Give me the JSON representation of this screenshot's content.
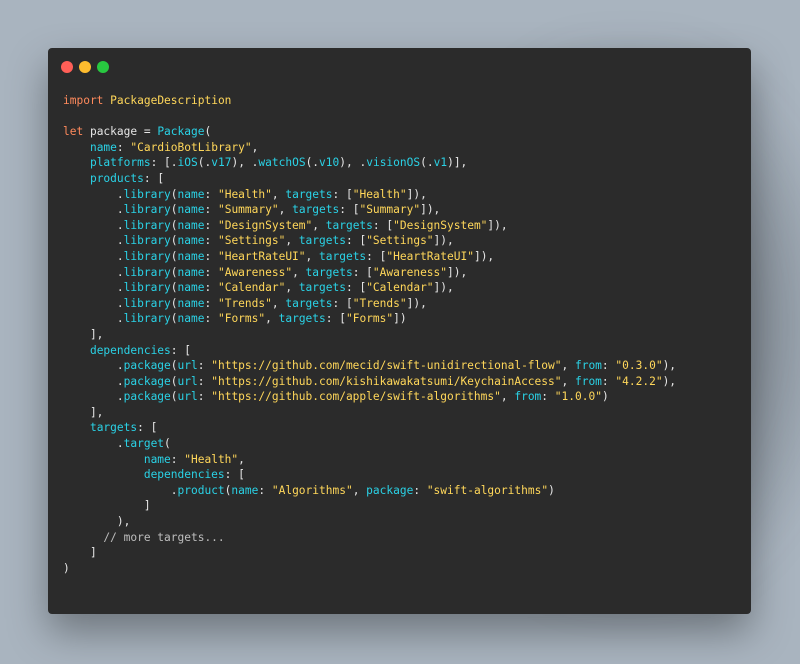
{
  "window": {
    "buttons": {
      "close": "close-button",
      "minimize": "minimize-button",
      "zoom": "zoom-button"
    }
  },
  "colors": {
    "background": "#a9b4bf",
    "window": "#2b2b2b",
    "keyword": "#ff8a5c",
    "type": "#2ad2e6",
    "string": "#ffd75a",
    "plain": "#e6e6e6"
  },
  "code": [
    [
      [
        "k",
        "import"
      ],
      [
        "p",
        " "
      ],
      [
        "s",
        "PackageDescription"
      ]
    ],
    [],
    [
      [
        "k",
        "let"
      ],
      [
        "p",
        " package = "
      ],
      [
        "t",
        "Package"
      ],
      [
        "p",
        "("
      ]
    ],
    [
      [
        "p",
        "    "
      ],
      [
        "t",
        "name"
      ],
      [
        "p",
        ": "
      ],
      [
        "s",
        "\"CardioBotLibrary\""
      ],
      [
        "p",
        ","
      ]
    ],
    [
      [
        "p",
        "    "
      ],
      [
        "t",
        "platforms"
      ],
      [
        "p",
        ": [."
      ],
      [
        "t",
        "iOS"
      ],
      [
        "p",
        "(."
      ],
      [
        "t",
        "v17"
      ],
      [
        "p",
        "), ."
      ],
      [
        "t",
        "watchOS"
      ],
      [
        "p",
        "(."
      ],
      [
        "t",
        "v10"
      ],
      [
        "p",
        "), ."
      ],
      [
        "t",
        "visionOS"
      ],
      [
        "p",
        "(."
      ],
      [
        "t",
        "v1"
      ],
      [
        "p",
        ")],"
      ]
    ],
    [
      [
        "p",
        "    "
      ],
      [
        "t",
        "products"
      ],
      [
        "p",
        ": ["
      ]
    ],
    [
      [
        "p",
        "        ."
      ],
      [
        "t",
        "library"
      ],
      [
        "p",
        "("
      ],
      [
        "t",
        "name"
      ],
      [
        "p",
        ": "
      ],
      [
        "s",
        "\"Health\""
      ],
      [
        "p",
        ", "
      ],
      [
        "t",
        "targets"
      ],
      [
        "p",
        ": ["
      ],
      [
        "s",
        "\"Health\""
      ],
      [
        "p",
        "]),"
      ]
    ],
    [
      [
        "p",
        "        ."
      ],
      [
        "t",
        "library"
      ],
      [
        "p",
        "("
      ],
      [
        "t",
        "name"
      ],
      [
        "p",
        ": "
      ],
      [
        "s",
        "\"Summary\""
      ],
      [
        "p",
        ", "
      ],
      [
        "t",
        "targets"
      ],
      [
        "p",
        ": ["
      ],
      [
        "s",
        "\"Summary\""
      ],
      [
        "p",
        "]),"
      ]
    ],
    [
      [
        "p",
        "        ."
      ],
      [
        "t",
        "library"
      ],
      [
        "p",
        "("
      ],
      [
        "t",
        "name"
      ],
      [
        "p",
        ": "
      ],
      [
        "s",
        "\"DesignSystem\""
      ],
      [
        "p",
        ", "
      ],
      [
        "t",
        "targets"
      ],
      [
        "p",
        ": ["
      ],
      [
        "s",
        "\"DesignSystem\""
      ],
      [
        "p",
        "]),"
      ]
    ],
    [
      [
        "p",
        "        ."
      ],
      [
        "t",
        "library"
      ],
      [
        "p",
        "("
      ],
      [
        "t",
        "name"
      ],
      [
        "p",
        ": "
      ],
      [
        "s",
        "\"Settings\""
      ],
      [
        "p",
        ", "
      ],
      [
        "t",
        "targets"
      ],
      [
        "p",
        ": ["
      ],
      [
        "s",
        "\"Settings\""
      ],
      [
        "p",
        "]),"
      ]
    ],
    [
      [
        "p",
        "        ."
      ],
      [
        "t",
        "library"
      ],
      [
        "p",
        "("
      ],
      [
        "t",
        "name"
      ],
      [
        "p",
        ": "
      ],
      [
        "s",
        "\"HeartRateUI\""
      ],
      [
        "p",
        ", "
      ],
      [
        "t",
        "targets"
      ],
      [
        "p",
        ": ["
      ],
      [
        "s",
        "\"HeartRateUI\""
      ],
      [
        "p",
        "]),"
      ]
    ],
    [
      [
        "p",
        "        ."
      ],
      [
        "t",
        "library"
      ],
      [
        "p",
        "("
      ],
      [
        "t",
        "name"
      ],
      [
        "p",
        ": "
      ],
      [
        "s",
        "\"Awareness\""
      ],
      [
        "p",
        ", "
      ],
      [
        "t",
        "targets"
      ],
      [
        "p",
        ": ["
      ],
      [
        "s",
        "\"Awareness\""
      ],
      [
        "p",
        "]),"
      ]
    ],
    [
      [
        "p",
        "        ."
      ],
      [
        "t",
        "library"
      ],
      [
        "p",
        "("
      ],
      [
        "t",
        "name"
      ],
      [
        "p",
        ": "
      ],
      [
        "s",
        "\"Calendar\""
      ],
      [
        "p",
        ", "
      ],
      [
        "t",
        "targets"
      ],
      [
        "p",
        ": ["
      ],
      [
        "s",
        "\"Calendar\""
      ],
      [
        "p",
        "]),"
      ]
    ],
    [
      [
        "p",
        "        ."
      ],
      [
        "t",
        "library"
      ],
      [
        "p",
        "("
      ],
      [
        "t",
        "name"
      ],
      [
        "p",
        ": "
      ],
      [
        "s",
        "\"Trends\""
      ],
      [
        "p",
        ", "
      ],
      [
        "t",
        "targets"
      ],
      [
        "p",
        ": ["
      ],
      [
        "s",
        "\"Trends\""
      ],
      [
        "p",
        "]),"
      ]
    ],
    [
      [
        "p",
        "        ."
      ],
      [
        "t",
        "library"
      ],
      [
        "p",
        "("
      ],
      [
        "t",
        "name"
      ],
      [
        "p",
        ": "
      ],
      [
        "s",
        "\"Forms\""
      ],
      [
        "p",
        ", "
      ],
      [
        "t",
        "targets"
      ],
      [
        "p",
        ": ["
      ],
      [
        "s",
        "\"Forms\""
      ],
      [
        "p",
        "])"
      ]
    ],
    [
      [
        "p",
        "    ],"
      ]
    ],
    [
      [
        "p",
        "    "
      ],
      [
        "t",
        "dependencies"
      ],
      [
        "p",
        ": ["
      ]
    ],
    [
      [
        "p",
        "        ."
      ],
      [
        "t",
        "package"
      ],
      [
        "p",
        "("
      ],
      [
        "t",
        "url"
      ],
      [
        "p",
        ": "
      ],
      [
        "s",
        "\"https://github.com/mecid/swift-unidirectional-flow\""
      ],
      [
        "p",
        ", "
      ],
      [
        "t",
        "from"
      ],
      [
        "p",
        ": "
      ],
      [
        "s",
        "\"0.3.0\""
      ],
      [
        "p",
        "),"
      ]
    ],
    [
      [
        "p",
        "        ."
      ],
      [
        "t",
        "package"
      ],
      [
        "p",
        "("
      ],
      [
        "t",
        "url"
      ],
      [
        "p",
        ": "
      ],
      [
        "s",
        "\"https://github.com/kishikawakatsumi/KeychainAccess\""
      ],
      [
        "p",
        ", "
      ],
      [
        "t",
        "from"
      ],
      [
        "p",
        ": "
      ],
      [
        "s",
        "\"4.2.2\""
      ],
      [
        "p",
        "),"
      ]
    ],
    [
      [
        "p",
        "        ."
      ],
      [
        "t",
        "package"
      ],
      [
        "p",
        "("
      ],
      [
        "t",
        "url"
      ],
      [
        "p",
        ": "
      ],
      [
        "s",
        "\"https://github.com/apple/swift-algorithms\""
      ],
      [
        "p",
        ", "
      ],
      [
        "t",
        "from"
      ],
      [
        "p",
        ": "
      ],
      [
        "s",
        "\"1.0.0\""
      ],
      [
        "p",
        ")"
      ]
    ],
    [
      [
        "p",
        "    ],"
      ]
    ],
    [
      [
        "p",
        "    "
      ],
      [
        "t",
        "targets"
      ],
      [
        "p",
        ": ["
      ]
    ],
    [
      [
        "p",
        "        ."
      ],
      [
        "t",
        "target"
      ],
      [
        "p",
        "("
      ]
    ],
    [
      [
        "p",
        "            "
      ],
      [
        "t",
        "name"
      ],
      [
        "p",
        ": "
      ],
      [
        "s",
        "\"Health\""
      ],
      [
        "p",
        ","
      ]
    ],
    [
      [
        "p",
        "            "
      ],
      [
        "t",
        "dependencies"
      ],
      [
        "p",
        ": ["
      ]
    ],
    [
      [
        "p",
        "                ."
      ],
      [
        "t",
        "product"
      ],
      [
        "p",
        "("
      ],
      [
        "t",
        "name"
      ],
      [
        "p",
        ": "
      ],
      [
        "s",
        "\"Algorithms\""
      ],
      [
        "p",
        ", "
      ],
      [
        "t",
        "package"
      ],
      [
        "p",
        ": "
      ],
      [
        "s",
        "\"swift-algorithms\""
      ],
      [
        "p",
        ")"
      ]
    ],
    [
      [
        "p",
        "            ]"
      ]
    ],
    [
      [
        "p",
        "        ),"
      ]
    ],
    [
      [
        "c",
        "      // more targets..."
      ]
    ],
    [
      [
        "p",
        "    ]"
      ]
    ],
    [
      [
        "p",
        ")"
      ]
    ]
  ]
}
